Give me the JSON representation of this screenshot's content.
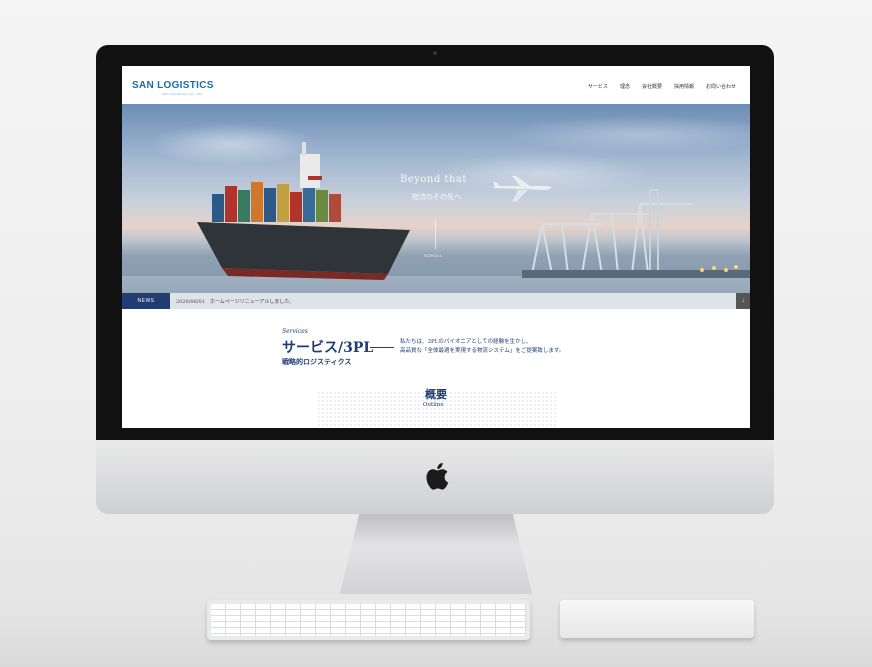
{
  "site": {
    "logo": "SAN LOGISTICS",
    "logo_sub": "SAN LOGISTICS CO.,LTD"
  },
  "nav": [
    "サービス",
    "理念",
    "会社概要",
    "採用情報",
    "お問い合わせ"
  ],
  "hero": {
    "headline": "Beyond that",
    "subhead": "物流のその先へ",
    "scroll": "SCROLL"
  },
  "news": {
    "tag": "NEWS",
    "text": "2020/06/01　ホームページリニューアルしました。",
    "arrow": "↓"
  },
  "services": {
    "label_en": "Services",
    "title": "サービス/3PL",
    "subtitle": "戦略的ロジスティクス",
    "desc_line1": "私たちは、3PLのパイオニアとしての経験を生かし、",
    "desc_line2": "高品質な「全体最適を実現する物流システム」をご提案致します。"
  },
  "outline": {
    "title_jp": "概要",
    "title_en": "Outline"
  },
  "colors": {
    "brand": "#1f3d72",
    "logo_blue": "#1a6fa8"
  }
}
